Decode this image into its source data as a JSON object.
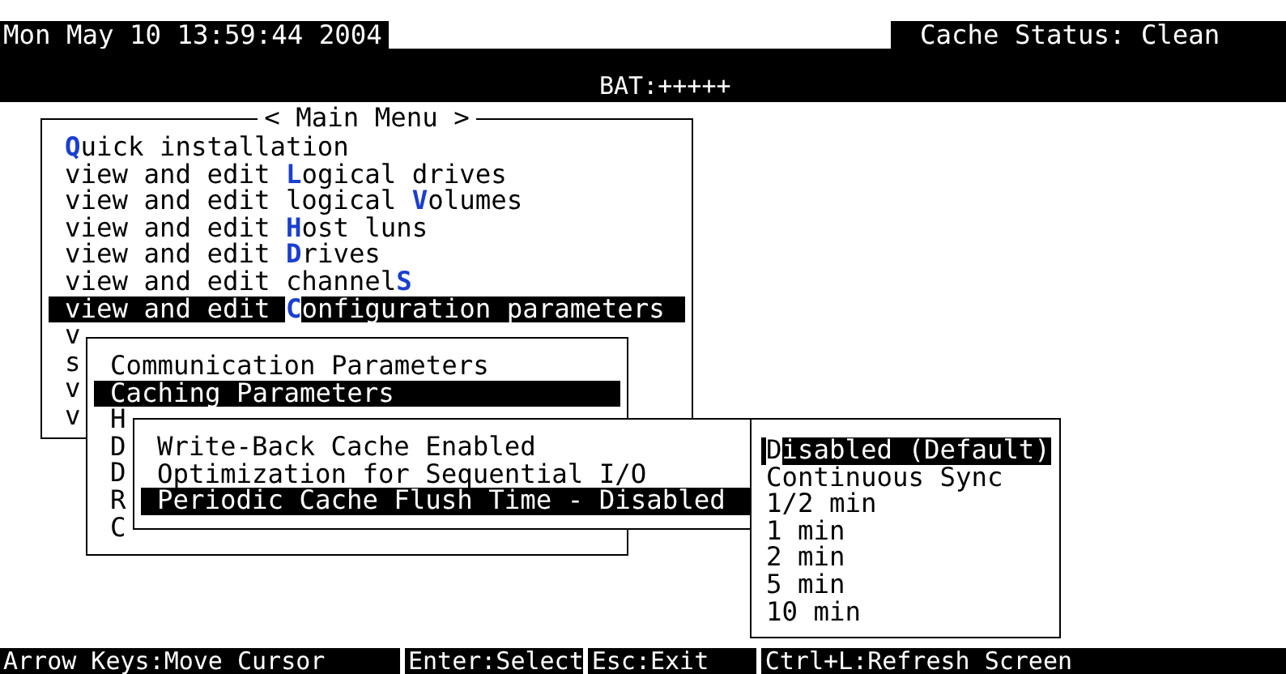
{
  "header": {
    "clock": "Mon May 10 13:59:44 2004",
    "cache_status": "Cache Status: Clean",
    "battery": "BAT:+++++"
  },
  "windows": [
    {
      "kind": "menu",
      "title": "< Main Menu >",
      "items": [
        {
          "hotkey": "Q",
          "rest": "uick installation",
          "selected": false
        },
        {
          "label": "view and edit ",
          "hotkey": "L",
          "rest": "ogical drives",
          "selected": false
        },
        {
          "label": "view and edit logical ",
          "hotkey": "V",
          "rest": "olumes",
          "selected": false
        },
        {
          "label": "view and edit ",
          "hotkey": "H",
          "rest": "ost luns",
          "selected": false
        },
        {
          "label": "view and edit ",
          "hotkey": "D",
          "rest": "rives",
          "selected": false
        },
        {
          "label": "view and edit channel",
          "hotkey": "S",
          "selected": false
        },
        {
          "label": "view and edit ",
          "hotkey": "C",
          "rest": "onfiguration parameters",
          "selected": true
        },
        {
          "label": "v",
          "selected": false
        },
        {
          "label": "s",
          "selected": false
        },
        {
          "label": "v",
          "selected": false
        },
        {
          "label": "v",
          "selected": false
        }
      ]
    },
    {
      "kind": "menu",
      "items": [
        {
          "label": "Communication Parameters",
          "selected": false
        },
        {
          "label": "Caching Parameters",
          "selected": true
        },
        {
          "label": "H",
          "selected": false
        },
        {
          "label": "D",
          "selected": false
        },
        {
          "label": "D",
          "selected": false
        },
        {
          "label": "R",
          "selected": false
        },
        {
          "label": "C",
          "selected": false
        }
      ]
    },
    {
      "kind": "menu",
      "items": [
        {
          "label": "Write-Back Cache Enabled",
          "selected": false
        },
        {
          "label": "Optimization for Sequential I/O",
          "selected": false
        },
        {
          "label": "Periodic Cache Flush Time - Disabled",
          "selected": true
        }
      ]
    },
    {
      "kind": "options",
      "items": [
        {
          "hotkey": "D",
          "rest": "isabled (Default)",
          "selected": true
        },
        {
          "label": "Continuous Sync",
          "selected": false
        },
        {
          "label": "1/2 min",
          "selected": false
        },
        {
          "label": "1 min",
          "selected": false
        },
        {
          "label": "2 min",
          "selected": false
        },
        {
          "label": "5 min",
          "selected": false
        },
        {
          "label": "10 min",
          "selected": false
        }
      ]
    }
  ],
  "status_bar": [
    "Arrow Keys:Move Cursor",
    "Enter:Select",
    "Esc:Exit",
    "Ctrl+L:Refresh Screen"
  ]
}
